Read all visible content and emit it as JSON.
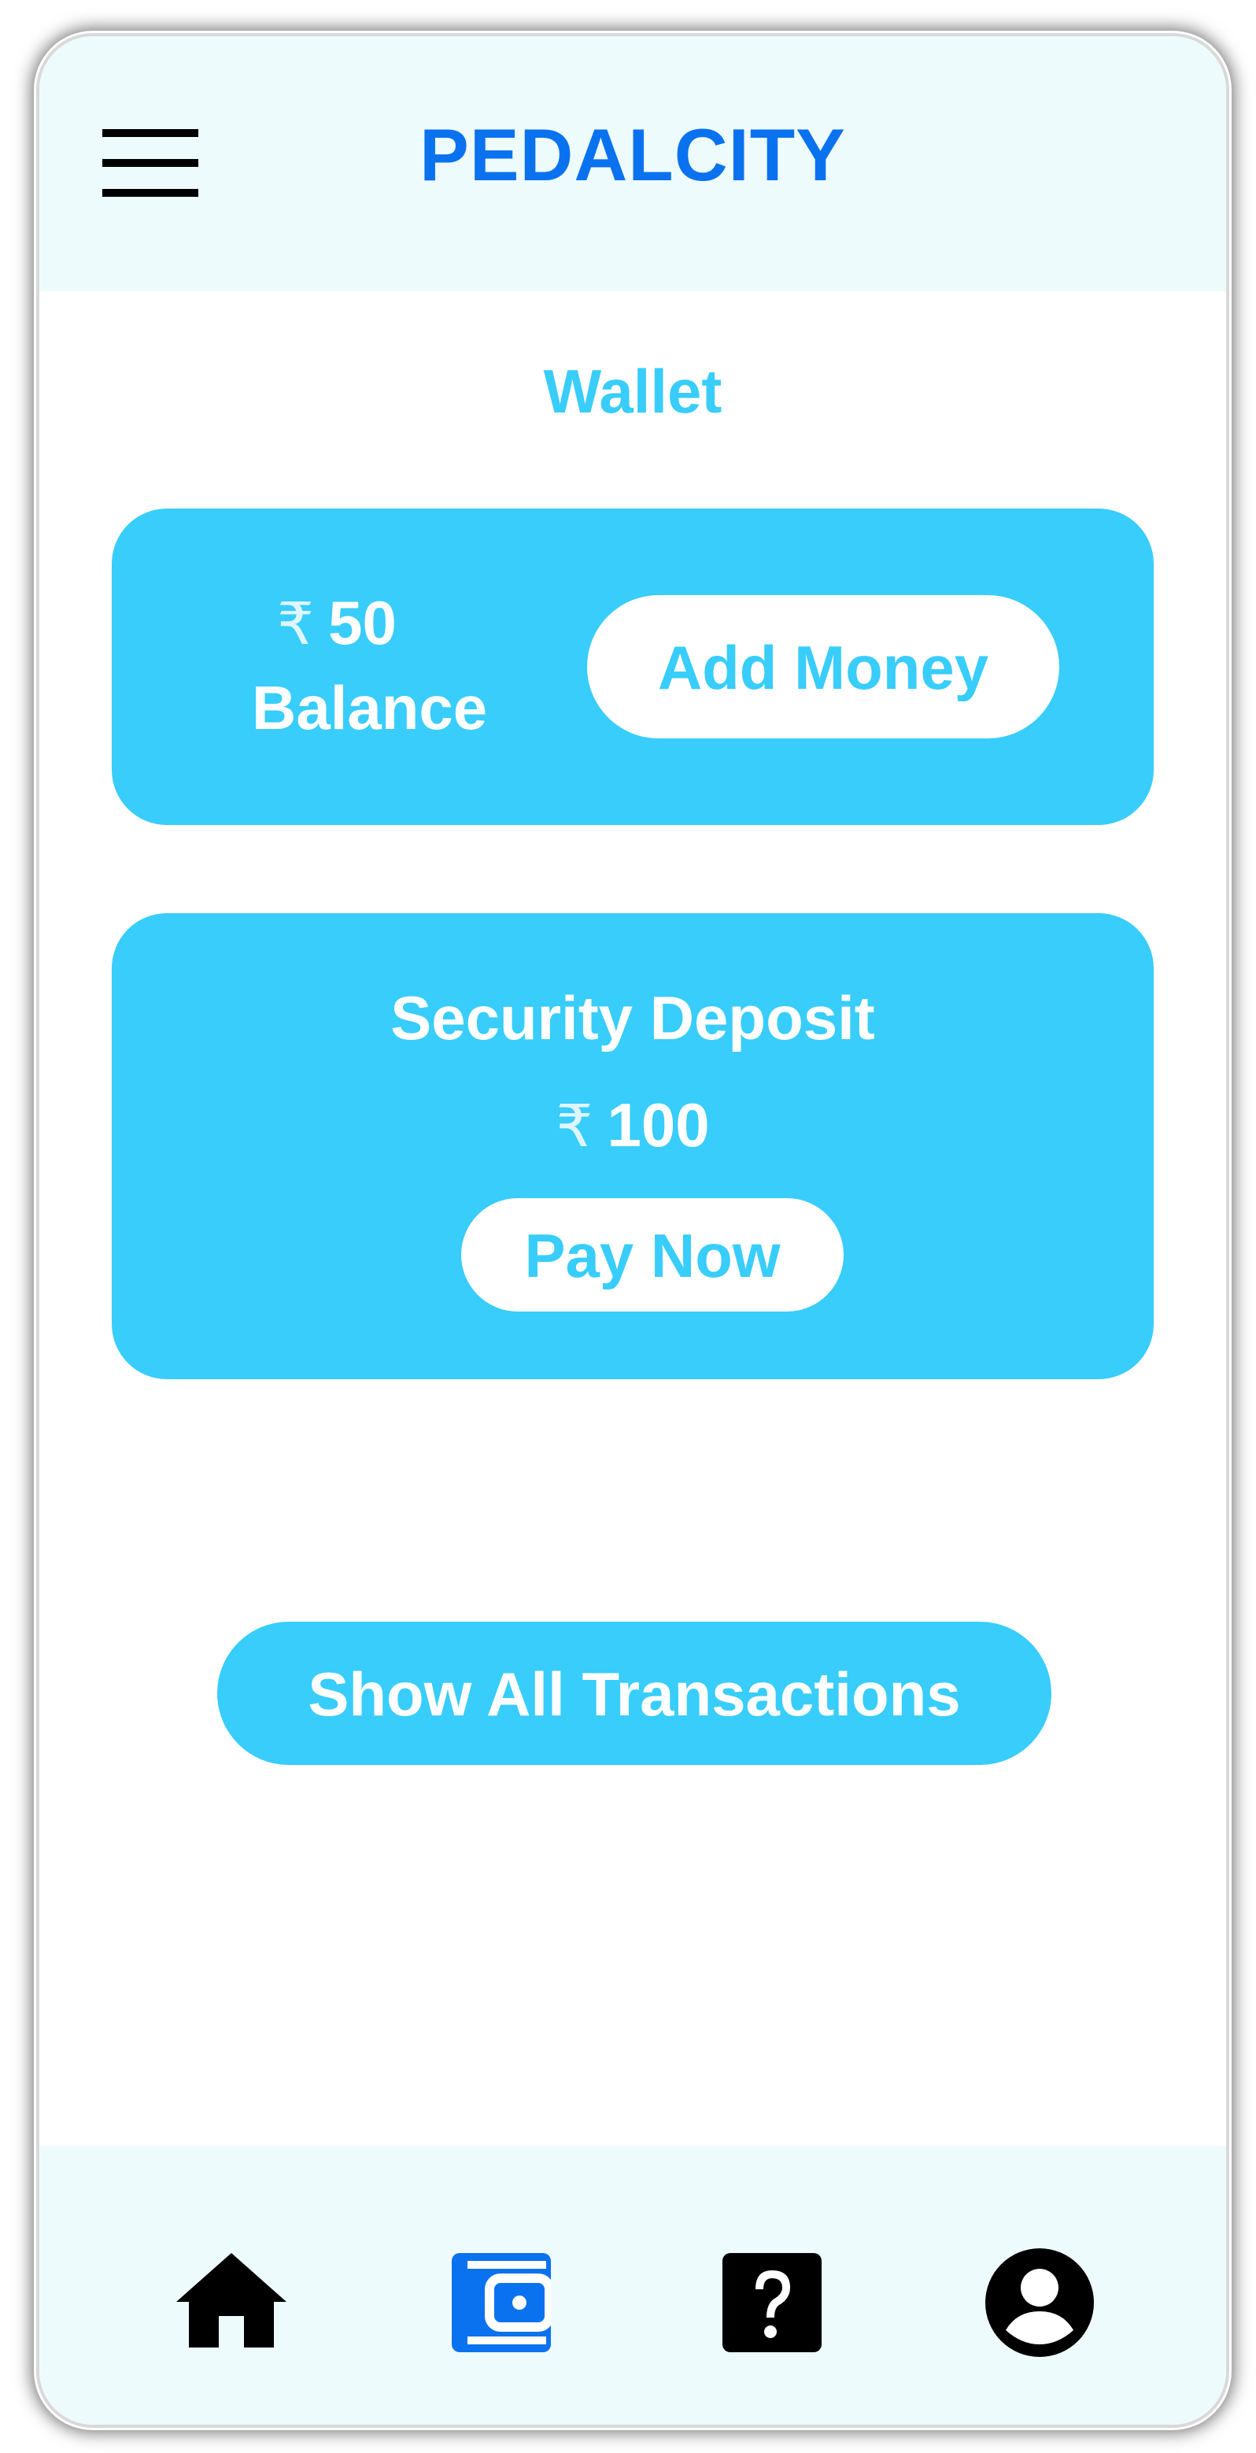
{
  "header": {
    "app_title": "PEDALCITY",
    "menu_icon": "hamburger-menu-icon"
  },
  "wallet": {
    "section_title": "Wallet",
    "balance": {
      "currency_symbol": "₹",
      "amount": "50",
      "label": "Balance",
      "add_money_label": "Add Money"
    },
    "security_deposit": {
      "title": "Security Deposit",
      "currency_symbol": "₹",
      "amount": "100",
      "pay_now_label": "Pay Now"
    },
    "show_all_transactions_label": "Show All Transactions"
  },
  "bottom_nav": {
    "items": [
      {
        "icon": "home-icon",
        "active": false
      },
      {
        "icon": "wallet-icon",
        "active": true
      },
      {
        "icon": "help-icon",
        "active": false
      },
      {
        "icon": "profile-icon",
        "active": false
      }
    ]
  },
  "colors": {
    "brand": "#0a72ef",
    "accent": "#38cdfa",
    "header_bg": "#eefbfd",
    "active_nav": "#0a72ef",
    "inactive_nav": "#000000"
  }
}
